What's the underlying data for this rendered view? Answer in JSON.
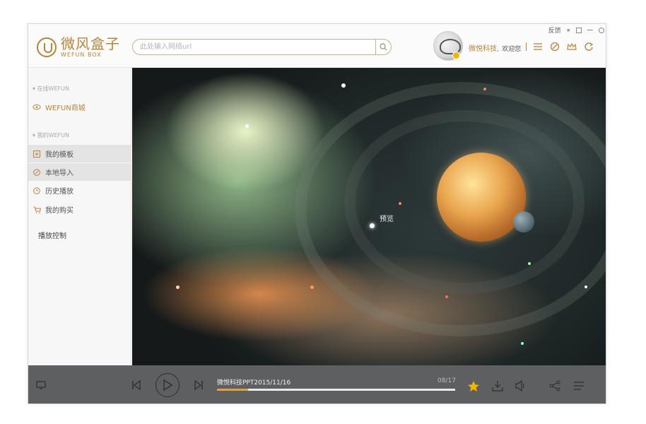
{
  "header": {
    "logo_cn": "微风盒子",
    "logo_en": "WEFUN BOX",
    "search_placeholder": "此处输入网络url",
    "user_name": "微悦科技,",
    "welcome": "欢迎您",
    "feedback": "反馈",
    "icons": [
      "list-icon",
      "compass-icon",
      "crown-icon",
      "refresh-icon"
    ]
  },
  "sidebar": {
    "section_online": "在线WEFUN",
    "online_items": [
      {
        "label": "WEFUN商城",
        "icon": "eye-icon"
      }
    ],
    "section_mine": "我的WEFUN",
    "mine_items": [
      {
        "label": "我的模板",
        "icon": "template-icon"
      },
      {
        "label": "本地导入",
        "icon": "import-icon"
      },
      {
        "label": "历史播放",
        "icon": "history-icon"
      },
      {
        "label": "我的购买",
        "icon": "cart-icon"
      }
    ],
    "play_control": "播放控制"
  },
  "stage": {
    "preview_label": "预览"
  },
  "player": {
    "title": "微悦科技PPT2015/11/16",
    "count": "08/17",
    "progress": 0.13,
    "accent": "#e0a23a"
  },
  "colors": {
    "brand": "#b8833a",
    "player_bg": "#5d5f61",
    "star": "#f3b400"
  }
}
